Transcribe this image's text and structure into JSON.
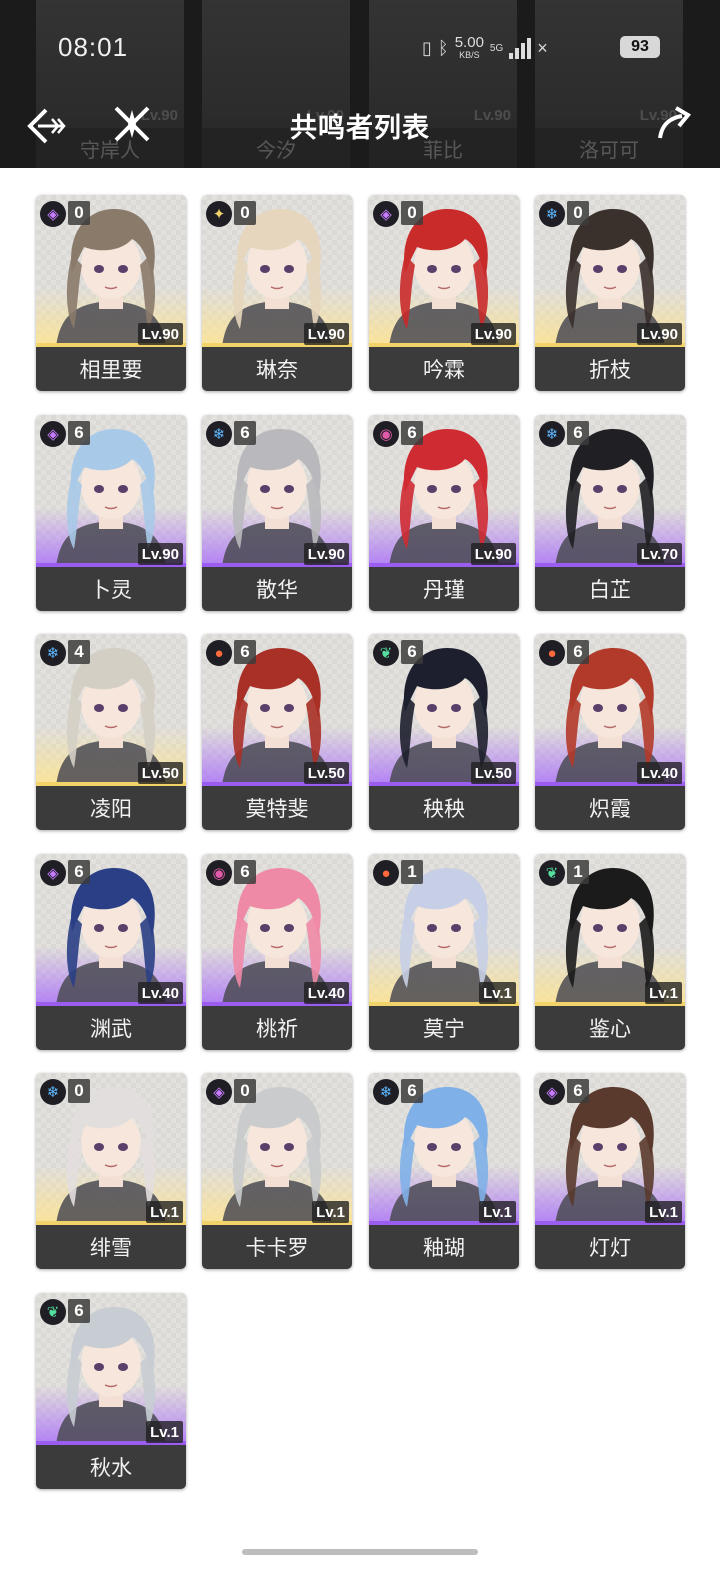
{
  "status_bar": {
    "time": "08:01",
    "net_speed": "5.00",
    "net_unit": "KB/S",
    "network": "5G",
    "battery": "93"
  },
  "header": {
    "title": "共鸣者列表",
    "ghost_names": [
      "守岸人",
      "今汐",
      "菲比",
      "洛可可"
    ],
    "ghost_level": "Lv.90"
  },
  "colors": {
    "header_bg": "#1b1b1b",
    "name_bar_bg": "#3b3b3b",
    "gold": "#f2d36a",
    "purple": "#9b5cf0"
  },
  "characters": [
    {
      "name": "相里要",
      "level": "Lv.90",
      "seq": "0",
      "element": "havoc-icon",
      "element_glyph": "◈",
      "element_color": "#c77bff",
      "rarity": "gold",
      "hair": "#8a7a6a"
    },
    {
      "name": "琳奈",
      "level": "Lv.90",
      "seq": "0",
      "element": "spectro-icon",
      "element_glyph": "✦",
      "element_color": "#f1d36b",
      "rarity": "gold",
      "hair": "#e6d6bd"
    },
    {
      "name": "吟霖",
      "level": "Lv.90",
      "seq": "0",
      "element": "electro-icon",
      "element_glyph": "◈",
      "element_color": "#c77bff",
      "rarity": "gold",
      "hair": "#c92a2a"
    },
    {
      "name": "折枝",
      "level": "Lv.90",
      "seq": "0",
      "element": "glacio-icon",
      "element_glyph": "❄",
      "element_color": "#5fb8ff",
      "rarity": "gold",
      "hair": "#3a302c"
    },
    {
      "name": "卜灵",
      "level": "Lv.90",
      "seq": "6",
      "element": "electro-icon",
      "element_glyph": "◈",
      "element_color": "#c77bff",
      "rarity": "purple",
      "hair": "#a9c9e8"
    },
    {
      "name": "散华",
      "level": "Lv.90",
      "seq": "6",
      "element": "glacio-icon",
      "element_glyph": "❄",
      "element_color": "#5fb8ff",
      "rarity": "purple",
      "hair": "#b9b9bd"
    },
    {
      "name": "丹瑾",
      "level": "Lv.90",
      "seq": "6",
      "element": "havoc-icon",
      "element_glyph": "◉",
      "element_color": "#e05aa8",
      "rarity": "purple",
      "hair": "#cf2b33"
    },
    {
      "name": "白芷",
      "level": "Lv.70",
      "seq": "6",
      "element": "glacio-icon",
      "element_glyph": "❄",
      "element_color": "#5fb8ff",
      "rarity": "purple",
      "hair": "#1f1f24"
    },
    {
      "name": "凌阳",
      "level": "Lv.50",
      "seq": "4",
      "element": "glacio-icon",
      "element_glyph": "❄",
      "element_color": "#5fb8ff",
      "rarity": "gold",
      "hair": "#d4cfc4"
    },
    {
      "name": "莫特斐",
      "level": "Lv.50",
      "seq": "6",
      "element": "fusion-icon",
      "element_glyph": "●",
      "element_color": "#ff6a3d",
      "rarity": "purple",
      "hair": "#a83026"
    },
    {
      "name": "秧秧",
      "level": "Lv.50",
      "seq": "6",
      "element": "aero-icon",
      "element_glyph": "❦",
      "element_color": "#55e0a0",
      "rarity": "purple",
      "hair": "#1d1f2e"
    },
    {
      "name": "炽霞",
      "level": "Lv.40",
      "seq": "6",
      "element": "fusion-icon",
      "element_glyph": "●",
      "element_color": "#ff6a3d",
      "rarity": "purple",
      "hair": "#b23a2a"
    },
    {
      "name": "渊武",
      "level": "Lv.40",
      "seq": "6",
      "element": "electro-icon",
      "element_glyph": "◈",
      "element_color": "#c77bff",
      "rarity": "purple",
      "hair": "#2a3f85"
    },
    {
      "name": "桃祈",
      "level": "Lv.40",
      "seq": "6",
      "element": "havoc-icon",
      "element_glyph": "◉",
      "element_color": "#e05aa8",
      "rarity": "purple",
      "hair": "#ef8aa6"
    },
    {
      "name": "莫宁",
      "level": "Lv.1",
      "seq": "1",
      "element": "fusion-icon",
      "element_glyph": "●",
      "element_color": "#ff6a3d",
      "rarity": "gold",
      "hair": "#c7cfe6"
    },
    {
      "name": "鉴心",
      "level": "Lv.1",
      "seq": "1",
      "element": "aero-icon",
      "element_glyph": "❦",
      "element_color": "#55e0a0",
      "rarity": "gold",
      "hair": "#1b1b1b"
    },
    {
      "name": "绯雪",
      "level": "Lv.1",
      "seq": "0",
      "element": "glacio-icon",
      "element_glyph": "❄",
      "element_color": "#5fb8ff",
      "rarity": "gold",
      "hair": "#e3dede"
    },
    {
      "name": "卡卡罗",
      "level": "Lv.1",
      "seq": "0",
      "element": "electro-icon",
      "element_glyph": "◈",
      "element_color": "#c77bff",
      "rarity": "gold",
      "hair": "#c9cbcc"
    },
    {
      "name": "釉瑚",
      "level": "Lv.1",
      "seq": "6",
      "element": "glacio-icon",
      "element_glyph": "❄",
      "element_color": "#5fb8ff",
      "rarity": "purple",
      "hair": "#7fb0e8"
    },
    {
      "name": "灯灯",
      "level": "Lv.1",
      "seq": "6",
      "element": "electro-icon",
      "element_glyph": "◈",
      "element_color": "#c77bff",
      "rarity": "purple",
      "hair": "#5a3a2c"
    },
    {
      "name": "秋水",
      "level": "Lv.1",
      "seq": "6",
      "element": "aero-icon",
      "element_glyph": "❦",
      "element_color": "#55e0a0",
      "rarity": "purple",
      "hair": "#c8cdd3"
    }
  ]
}
